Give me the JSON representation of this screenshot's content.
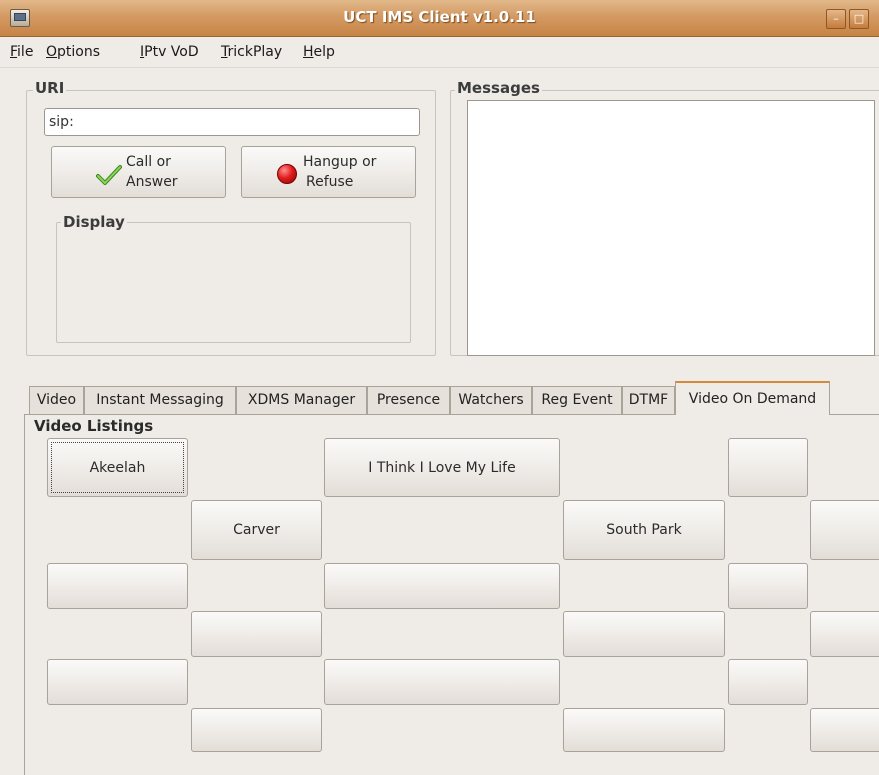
{
  "window": {
    "title": "UCT IMS Client v1.0.11",
    "minimize_glyph": "–",
    "maximize_glyph": "□"
  },
  "menu": {
    "items": [
      {
        "mnemonic": "F",
        "rest": "ile"
      },
      {
        "mnemonic": "O",
        "rest": "ptions"
      },
      {
        "mnemonic": "I",
        "rest": "Ptv VoD"
      },
      {
        "mnemonic": "T",
        "rest": "rickPlay"
      },
      {
        "mnemonic": "H",
        "rest": "elp"
      }
    ]
  },
  "uri": {
    "group_label": "URI",
    "value": "sip:",
    "call_button": {
      "line1": "Call or",
      "line2": "Answer",
      "icon": "check-icon"
    },
    "hangup_button": {
      "line1": "Hangup or",
      "line2": "Refuse",
      "icon": "red-circle-icon"
    },
    "display_label": "Display"
  },
  "messages": {
    "group_label": "Messages"
  },
  "tabs": [
    {
      "label": "Video",
      "active": false
    },
    {
      "label": "Instant Messaging",
      "active": false
    },
    {
      "label": "XDMS Manager",
      "active": false
    },
    {
      "label": "Presence",
      "active": false
    },
    {
      "label": "Watchers",
      "active": false
    },
    {
      "label": "Reg Event",
      "active": false
    },
    {
      "label": "DTMF",
      "active": false
    },
    {
      "label": "Video On Demand",
      "active": true
    }
  ],
  "video_on_demand": {
    "section_label": "Video Listings",
    "videos": [
      {
        "label": "Akeelah",
        "focused": true
      },
      {
        "label": "I Think I Love My Life"
      },
      {
        "label": "Carver"
      },
      {
        "label": "South Park"
      },
      {
        "label": ""
      },
      {
        "label": ""
      },
      {
        "label": ""
      },
      {
        "label": ""
      },
      {
        "label": ""
      },
      {
        "label": ""
      },
      {
        "label": ""
      },
      {
        "label": ""
      },
      {
        "label": ""
      },
      {
        "label": ""
      },
      {
        "label": ""
      },
      {
        "label": ""
      },
      {
        "label": ""
      },
      {
        "label": ""
      },
      {
        "label": ""
      },
      {
        "label": ""
      }
    ]
  },
  "colors": {
    "title_bar": "#c78446",
    "window_bg": "#efebe7",
    "active_tab_accent": "#d48a3b"
  }
}
